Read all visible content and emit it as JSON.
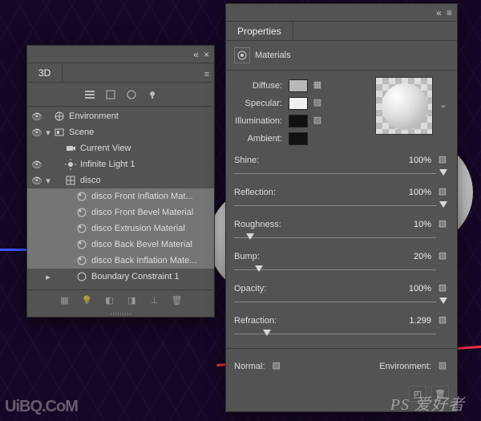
{
  "watermark_right": "PS 爱好者",
  "watermark_left": "UiBQ.CoM",
  "panel3d": {
    "title": "3D",
    "items": [
      {
        "label": "Environment",
        "icon": "env",
        "eye": true,
        "indent": 0,
        "tw": ""
      },
      {
        "label": "Scene",
        "icon": "scene",
        "eye": true,
        "indent": 0,
        "tw": "▾"
      },
      {
        "label": "Current View",
        "icon": "camera",
        "eye": false,
        "indent": 1,
        "tw": ""
      },
      {
        "label": "Infinite Light 1",
        "icon": "sun",
        "eye": true,
        "indent": 1,
        "tw": ""
      },
      {
        "label": "disco",
        "icon": "mesh",
        "eye": true,
        "indent": 1,
        "tw": "▾"
      },
      {
        "label": "disco Front Inflation Mat...",
        "icon": "mat",
        "eye": false,
        "indent": 2,
        "tw": "",
        "sel": true
      },
      {
        "label": "disco Front Bevel Material",
        "icon": "mat",
        "eye": false,
        "indent": 2,
        "tw": "",
        "sel": true
      },
      {
        "label": "disco Extrusion Material",
        "icon": "mat",
        "eye": false,
        "indent": 2,
        "tw": "",
        "sel": true
      },
      {
        "label": "disco Back Bevel Material",
        "icon": "mat",
        "eye": false,
        "indent": 2,
        "tw": "",
        "sel": true
      },
      {
        "label": "disco Back Inflation Mate...",
        "icon": "mat",
        "eye": false,
        "indent": 2,
        "tw": "",
        "sel": true
      },
      {
        "label": "Boundary Constraint 1",
        "icon": "circle",
        "eye": false,
        "indent": 2,
        "tw": "▸"
      }
    ]
  },
  "props": {
    "title": "Properties",
    "section": "Materials",
    "channels": {
      "diffuse": {
        "label": "Diffuse:"
      },
      "specular": {
        "label": "Specular:"
      },
      "illumination": {
        "label": "Illumination:"
      },
      "ambient": {
        "label": "Ambient:"
      }
    },
    "sliders": {
      "shine": {
        "label": "Shine:",
        "value": "100%",
        "pos": 100
      },
      "reflection": {
        "label": "Reflection:",
        "value": "100%",
        "pos": 100
      },
      "roughness": {
        "label": "Roughness:",
        "value": "10%",
        "pos": 10
      },
      "bump": {
        "label": "Bump:",
        "value": "20%",
        "pos": 14
      },
      "opacity": {
        "label": "Opacity:",
        "value": "100%",
        "pos": 100
      },
      "refraction": {
        "label": "Refraction:",
        "value": "1.299",
        "pos": 18
      }
    },
    "normal": "Normal:",
    "environment": "Environment:"
  }
}
